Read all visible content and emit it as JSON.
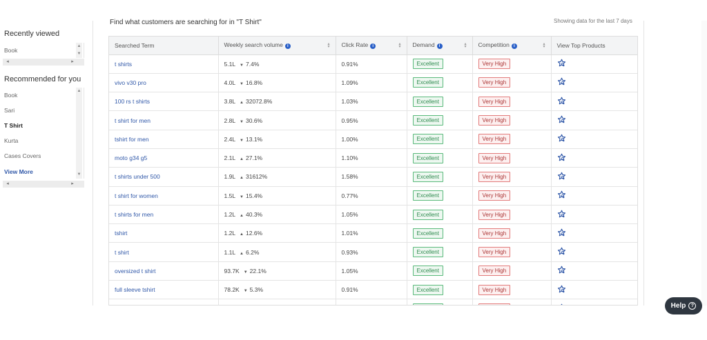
{
  "sidebar": {
    "recently_viewed_title": "Recently viewed",
    "recently_viewed": [
      "Book"
    ],
    "recommended_title": "Recommended for you",
    "recommended": [
      "Book",
      "Sari",
      "T Shirt",
      "Kurta",
      "Cases Covers"
    ],
    "view_more": "View More"
  },
  "main": {
    "heading": "Find what customers are searching for in \"T Shirt\"",
    "showing": "Showing data for the last 7 days"
  },
  "table": {
    "headers": {
      "term": "Searched Term",
      "volume": "Weekly search volume",
      "click": "Click Rate",
      "demand": "Demand",
      "competition": "Competition",
      "products": "View Top Products"
    },
    "rows": [
      {
        "term": "t shirts",
        "volume": "5.1L",
        "dir": "▼",
        "change": "7.4%",
        "click": "0.91%",
        "demand": "Excellent",
        "competition": "Very High"
      },
      {
        "term": "vivo v30 pro",
        "volume": "4.0L",
        "dir": "▼",
        "change": "16.8%",
        "click": "1.09%",
        "demand": "Excellent",
        "competition": "Very High"
      },
      {
        "term": "100 rs t shirts",
        "volume": "3.8L",
        "dir": "▲",
        "change": "32072.8%",
        "click": "1.03%",
        "demand": "Excellent",
        "competition": "Very High"
      },
      {
        "term": "t shirt for men",
        "volume": "2.8L",
        "dir": "▼",
        "change": "30.6%",
        "click": "0.95%",
        "demand": "Excellent",
        "competition": "Very High"
      },
      {
        "term": "tshirt for men",
        "volume": "2.4L",
        "dir": "▼",
        "change": "13.1%",
        "click": "1.00%",
        "demand": "Excellent",
        "competition": "Very High"
      },
      {
        "term": "moto g34 g5",
        "volume": "2.1L",
        "dir": "▲",
        "change": "27.1%",
        "click": "1.10%",
        "demand": "Excellent",
        "competition": "Very High"
      },
      {
        "term": "t shirts under 500",
        "volume": "1.9L",
        "dir": "▲",
        "change": "31612%",
        "click": "1.58%",
        "demand": "Excellent",
        "competition": "Very High"
      },
      {
        "term": "t shirt for women",
        "volume": "1.5L",
        "dir": "▼",
        "change": "15.4%",
        "click": "0.77%",
        "demand": "Excellent",
        "competition": "Very High"
      },
      {
        "term": "t shirts for men",
        "volume": "1.2L",
        "dir": "▲",
        "change": "40.3%",
        "click": "1.05%",
        "demand": "Excellent",
        "competition": "Very High"
      },
      {
        "term": "tshirt",
        "volume": "1.2L",
        "dir": "▲",
        "change": "12.6%",
        "click": "1.01%",
        "demand": "Excellent",
        "competition": "Very High"
      },
      {
        "term": "t shirt",
        "volume": "1.1L",
        "dir": "▲",
        "change": "6.2%",
        "click": "0.93%",
        "demand": "Excellent",
        "competition": "Very High"
      },
      {
        "term": "oversized t shirt",
        "volume": "93.7K",
        "dir": "▼",
        "change": "22.1%",
        "click": "1.05%",
        "demand": "Excellent",
        "competition": "Very High"
      },
      {
        "term": "full sleeve tshirt",
        "volume": "78.2K",
        "dir": "▼",
        "change": "5.3%",
        "click": "0.91%",
        "demand": "Excellent",
        "competition": "Very High"
      },
      {
        "term": "",
        "volume": "",
        "dir": "",
        "change": "",
        "click": "",
        "demand": "Excellent",
        "competition": "Very High"
      }
    ]
  },
  "help": {
    "label": "Help"
  },
  "colors": {
    "link": "#2f57a8",
    "info": "#2a60c8",
    "green": "#2d8a4e",
    "red": "#a33333",
    "help_bg": "#2f3740"
  },
  "icons": {
    "star": "star-search-icon",
    "info": "info-icon",
    "sort": "sort-icon",
    "help": "question-icon"
  }
}
